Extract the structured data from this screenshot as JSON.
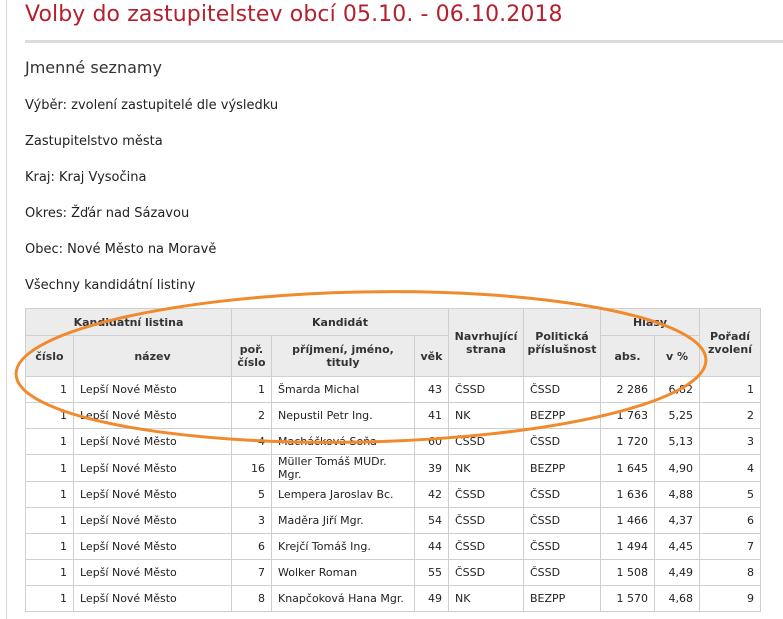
{
  "page": {
    "title": "Volby do zastupitelstev obcí 05.10. - 06.10.2018",
    "section_title": "Jmenné seznamy",
    "info": [
      "Výběr: zvolení zastupitelé dle výsledku",
      "Zastupitelstvo města",
      "Kraj: Kraj Vysočina",
      "Okres: Žďár nad Sázavou",
      "Obec: Nové Město na Moravě",
      "Všechny kandidátní listiny"
    ]
  },
  "table": {
    "group_headers": {
      "list": "Kandidátní listina",
      "candidate": "Kandidát",
      "proposing": "Navrhující strana",
      "political": "Politická příslušnost",
      "votes": "Hlasy",
      "order": "Pořadí zvolení"
    },
    "sub_headers": {
      "number": "číslo",
      "name": "název",
      "seq": "poř. číslo",
      "fullname": "příjmení, jméno, tituly",
      "age": "věk",
      "abs": "abs.",
      "pct": "v %"
    },
    "rows": [
      {
        "list_no": "1",
        "list_name": "Lepší Nové Město",
        "seq": "1",
        "name": "Šmarda Michal",
        "age": "43",
        "party": "ČSSD",
        "affiliation": "ČSSD",
        "abs": "2 286",
        "pct": "6,82",
        "order": "1"
      },
      {
        "list_no": "1",
        "list_name": "Lepší Nové Město",
        "seq": "2",
        "name": "Nepustil Petr Ing.",
        "age": "41",
        "party": "NK",
        "affiliation": "BEZPP",
        "abs": "1 763",
        "pct": "5,25",
        "order": "2"
      },
      {
        "list_no": "1",
        "list_name": "Lepší Nové Město",
        "seq": "4",
        "name": "Macháčková Soňa",
        "age": "60",
        "party": "ČSSD",
        "affiliation": "ČSSD",
        "abs": "1 720",
        "pct": "5,13",
        "order": "3"
      },
      {
        "list_no": "1",
        "list_name": "Lepší Nové Město",
        "seq": "16",
        "name": "Müller Tomáš MUDr. Mgr.",
        "age": "39",
        "party": "NK",
        "affiliation": "BEZPP",
        "abs": "1 645",
        "pct": "4,90",
        "order": "4"
      },
      {
        "list_no": "1",
        "list_name": "Lepší Nové Město",
        "seq": "5",
        "name": "Lempera Jaroslav Bc.",
        "age": "42",
        "party": "ČSSD",
        "affiliation": "ČSSD",
        "abs": "1 636",
        "pct": "4,88",
        "order": "5"
      },
      {
        "list_no": "1",
        "list_name": "Lepší Nové Město",
        "seq": "3",
        "name": "Maděra Jiří Mgr.",
        "age": "54",
        "party": "ČSSD",
        "affiliation": "ČSSD",
        "abs": "1 466",
        "pct": "4,37",
        "order": "6"
      },
      {
        "list_no": "1",
        "list_name": "Lepší Nové Město",
        "seq": "6",
        "name": "Krejčí Tomáš Ing.",
        "age": "44",
        "party": "ČSSD",
        "affiliation": "ČSSD",
        "abs": "1 494",
        "pct": "4,45",
        "order": "7"
      },
      {
        "list_no": "1",
        "list_name": "Lepší Nové Město",
        "seq": "7",
        "name": "Wolker Roman",
        "age": "55",
        "party": "ČSSD",
        "affiliation": "ČSSD",
        "abs": "1 508",
        "pct": "4,49",
        "order": "8"
      },
      {
        "list_no": "1",
        "list_name": "Lepší Nové Město",
        "seq": "8",
        "name": "Knapčoková Hana Mgr.",
        "age": "49",
        "party": "NK",
        "affiliation": "BEZPP",
        "abs": "1 570",
        "pct": "4,68",
        "order": "9"
      }
    ]
  },
  "annotation": {
    "shape": "ellipse",
    "color": "#f08a2c"
  }
}
